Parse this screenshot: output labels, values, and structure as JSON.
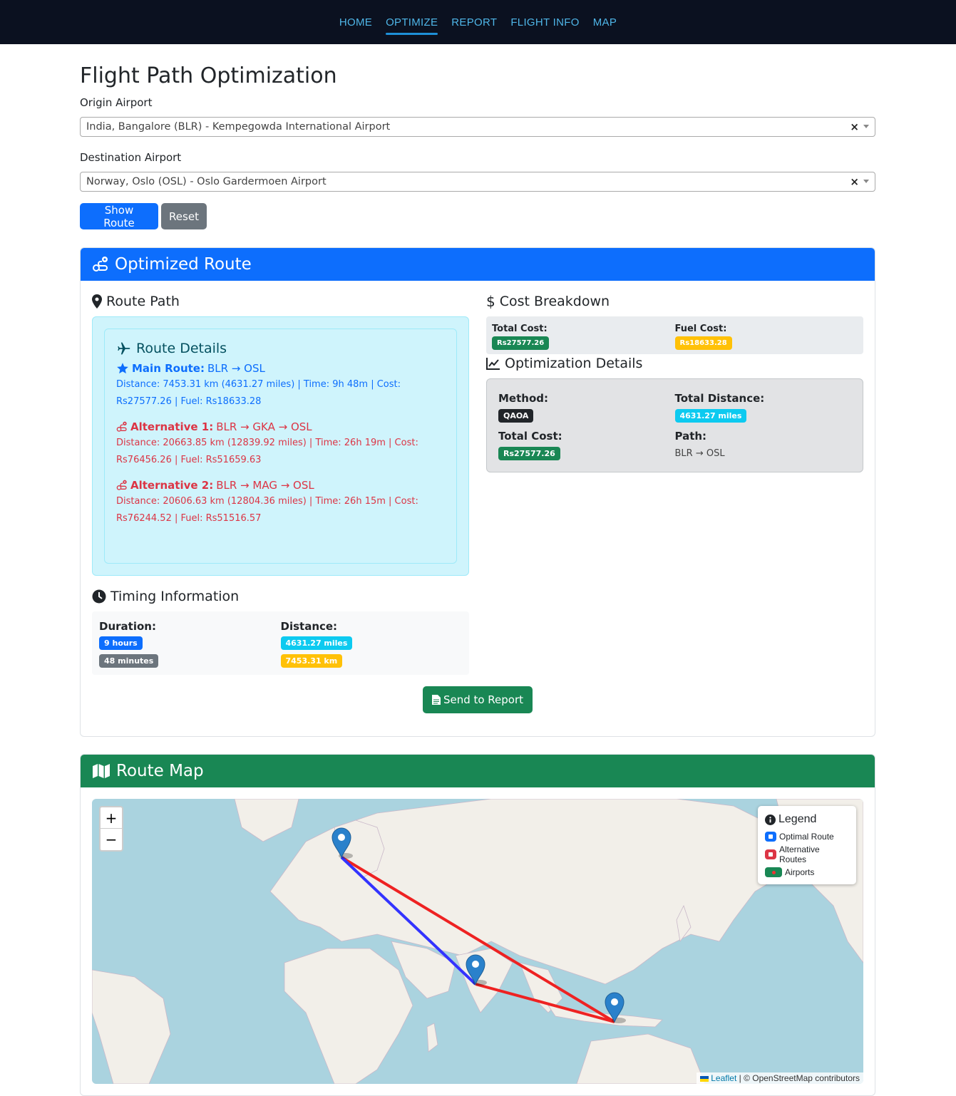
{
  "nav": {
    "items": [
      {
        "label": "HOME"
      },
      {
        "label": "OPTIMIZE"
      },
      {
        "label": "REPORT"
      },
      {
        "label": "FLIGHT INFO"
      },
      {
        "label": "MAP"
      }
    ],
    "active_index": 1
  },
  "page": {
    "title": "Flight Path Optimization",
    "origin_label": "Origin Airport",
    "origin_value": "India, Bangalore (BLR) - Kempegowda International Airport",
    "destination_label": "Destination Airport",
    "destination_value": "Norway, Oslo (OSL) - Oslo Gardermoen Airport",
    "clear_glyph": "×",
    "show_route_label": "Show Route",
    "reset_label": "Reset"
  },
  "optimized": {
    "header": "Optimized Route",
    "route_path_title": "Route Path",
    "route_details_title": "Route Details",
    "main_route": {
      "label": "Main Route:",
      "path": "BLR → OSL",
      "desc": "Distance: 7453.31 km (4631.27 miles) | Time: 9h 48m | Cost: Rs27577.26 | Fuel: Rs18633.28"
    },
    "alternatives": [
      {
        "label": "Alternative 1:",
        "path": "BLR → GKA → OSL",
        "desc": "Distance: 20663.85 km (12839.92 miles) | Time: 26h 19m | Cost: Rs76456.26 | Fuel: Rs51659.63"
      },
      {
        "label": "Alternative 2:",
        "path": "BLR → MAG → OSL",
        "desc": "Distance: 20606.63 km (12804.36 miles) | Time: 26h 15m | Cost: Rs76244.52 | Fuel: Rs51516.57"
      }
    ],
    "cost_title": "Cost Breakdown",
    "total_cost_label": "Total Cost:",
    "total_cost_value": "Rs27577.26",
    "fuel_cost_label": "Fuel Cost:",
    "fuel_cost_value": "Rs18633.28",
    "opt_title": "Optimization Details",
    "method_label": "Method:",
    "method_value": "QAOA",
    "total_distance_label": "Total Distance:",
    "total_distance_value": "4631.27 miles",
    "opt_total_cost_label": "Total Cost:",
    "opt_total_cost_value": "Rs27577.26",
    "path_label": "Path:",
    "path_value": "BLR → OSL",
    "timing_title": "Timing Information",
    "duration_label": "Duration:",
    "hours_value": "9 hours",
    "minutes_value": "48 minutes",
    "distance_label": "Distance:",
    "miles_value": "4631.27 miles",
    "km_value": "7453.31 km",
    "send_label": "Send to Report"
  },
  "map": {
    "header": "Route Map",
    "zoom_in": "+",
    "zoom_out": "−",
    "legend_title": "Legend",
    "legend_items": [
      {
        "label": "Optimal Route",
        "color": "#0d6efd"
      },
      {
        "label": "Alternative Routes",
        "color": "#dc3545"
      },
      {
        "label": "Airports",
        "color": "#198754"
      }
    ],
    "attribution_link": "Leaflet",
    "attribution_text": " | © OpenStreetMap contributors",
    "optimal_color": "#3333ff",
    "alternative_color": "#ee2222"
  },
  "colors": {
    "nav_bg": "#0b1120",
    "nav_link": "#4fb6e8",
    "primary": "#0d6efd",
    "success": "#198754",
    "danger": "#dc3545"
  }
}
